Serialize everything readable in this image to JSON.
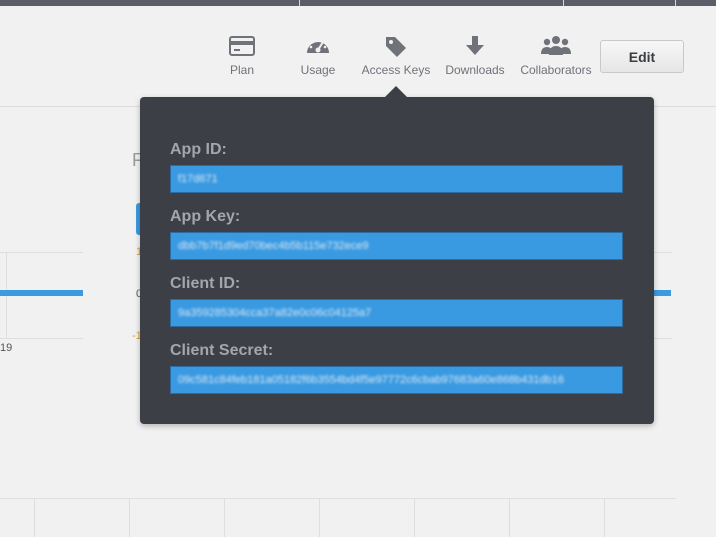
{
  "nav": {
    "items": [
      {
        "label": "Plan",
        "icon": "credit-card-icon"
      },
      {
        "label": "Usage",
        "icon": "speedometer-icon"
      },
      {
        "label": "Access Keys",
        "icon": "tag-icon"
      },
      {
        "label": "Downloads",
        "icon": "download-arrow-icon"
      },
      {
        "label": "Collaborators",
        "icon": "group-icon"
      }
    ],
    "edit_label": "Edit"
  },
  "background": {
    "partial_letter": "F",
    "tick_left": "19",
    "mark_1": "1",
    "mark_0": "0",
    "mark_neg": "-1"
  },
  "popover": {
    "fields": [
      {
        "label": "App ID:",
        "value": "f17d671"
      },
      {
        "label": "App Key:",
        "value": "dbb7b7f1d9ed70bec4b5b115e732ece9"
      },
      {
        "label": "Client ID:",
        "value": "9a359285304cca37a82e0c06c04125a7"
      },
      {
        "label": "Client Secret:",
        "value": "09c581c84feb181a05182f6b3554bd4f5e97772c6cbab97683a60e868b431db16"
      }
    ]
  },
  "colors": {
    "popover_bg": "#3c3f45",
    "field_bg": "#3a9ae1",
    "chart_blue": "#3b9ae0"
  }
}
